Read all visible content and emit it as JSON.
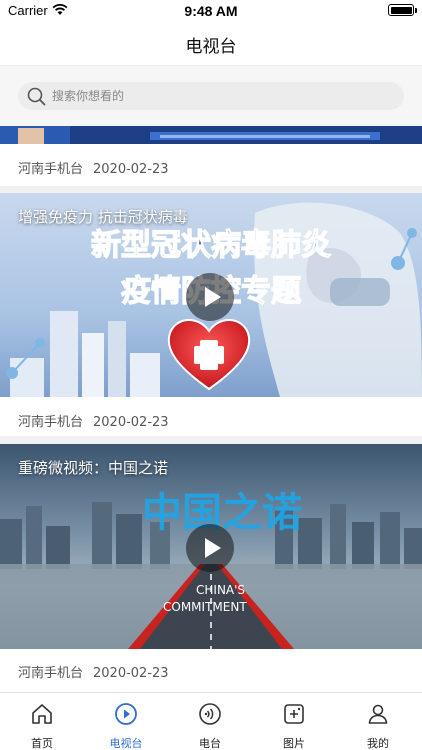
{
  "status_bar": {
    "carrier": "Carrier",
    "time": "9:48 AM"
  },
  "nav": {
    "title": "电视台"
  },
  "search": {
    "placeholder": "搜索你想看的"
  },
  "videos": [
    {
      "title": "",
      "source": "河南手机台",
      "date": "2020-02-23"
    },
    {
      "title": "增强免疫力 抗击冠状病毒",
      "poster_text": [
        "新型冠状病毒肺炎",
        "疫情防控专题"
      ],
      "source": "河南手机台",
      "date": "2020-02-23"
    },
    {
      "title": "重磅微视频：中国之诺",
      "poster_text": [
        "中国之诺",
        "CHINA'S",
        "COMMITMENT"
      ],
      "source": "河南手机台",
      "date": "2020-02-23"
    }
  ],
  "tabs": [
    {
      "label": "首页",
      "icon": "home-icon"
    },
    {
      "label": "电视台",
      "icon": "play-circle-icon",
      "active": true
    },
    {
      "label": "电台",
      "icon": "radio-icon"
    },
    {
      "label": "图片",
      "icon": "image-icon"
    },
    {
      "label": "我的",
      "icon": "profile-icon"
    }
  ],
  "colors": {
    "accent": "#2f6fc9",
    "background": "#f1f1f1",
    "text": "#222222"
  }
}
